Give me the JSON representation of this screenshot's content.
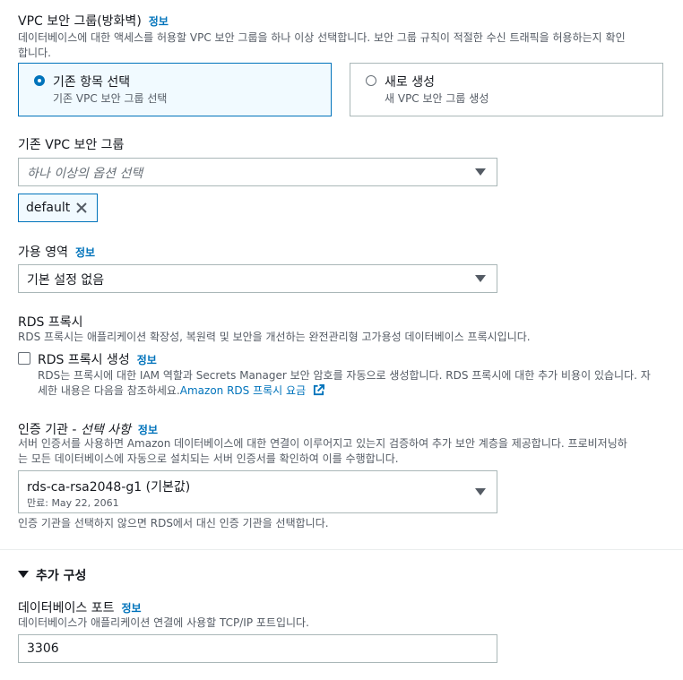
{
  "vpc_sg": {
    "title": "VPC 보안 그룹(방화벽)",
    "info": "정보",
    "desc_line1": "데이터베이스에 대한 액세스를 허용할 VPC 보안 그룹을 하나 이상 선택합니다. 보안 그룹 규칙이 적절한 수신 트래픽을 허용하는지 확인",
    "desc_line2": "합니다.",
    "options": [
      {
        "title": "기존 항목 선택",
        "sub": "기존 VPC 보안 그룹 선택",
        "selected": true
      },
      {
        "title": "새로 생성",
        "sub": "새 VPC 보안 그룹 생성",
        "selected": false
      }
    ]
  },
  "existing_sg": {
    "label": "기존 VPC 보안 그룹",
    "placeholder": "하나 이상의 옵션 선택",
    "token": "default"
  },
  "az": {
    "label": "가용 영역",
    "info": "정보",
    "value": "기본 설정 없음"
  },
  "rds_proxy": {
    "title": "RDS 프록시",
    "desc": "RDS 프록시는 애플리케이션 확장성, 복원력 및 보안을 개선하는 완전관리형 고가용성 데이터베이스 프록시입니다.",
    "checkbox_label": "RDS 프록시 생성",
    "info": "정보",
    "checkbox_desc_line1": "RDS는 프록시에 대한 IAM 역할과 Secrets Manager 보안 암호를 자동으로 생성합니다. RDS 프록시에 대한 추가 비용이 있습니다. 자",
    "checkbox_desc_line2": "세한 내용은 다음을 참조하세요.",
    "pricing_link": "Amazon RDS 프록시 요금"
  },
  "ca": {
    "label": "인증 기관 - ",
    "label_optional": "선택 사항",
    "info": "정보",
    "desc_line1": "서버 인증서를 사용하면 Amazon 데이터베이스에 대한 연결이 이루어지고 있는지 검증하여 추가 보안 계층을 제공합니다. 프로비저닝하",
    "desc_line2": "는 모든 데이터베이스에 자동으로 설치되는 서버 인증서를 확인하여 이를 수행합니다.",
    "value": "rds-ca-rsa2048-g1 (기본값)",
    "value_sub": "만료: May 22, 2061",
    "hint": "인증 기관을 선택하지 않으면 RDS에서 대신 인증 기관을 선택합니다."
  },
  "additional": {
    "title": "추가 구성"
  },
  "db_port": {
    "label": "데이터베이스 포트",
    "info": "정보",
    "desc": "데이터베이스가 애플리케이션 연결에 사용할 TCP/IP 포트입니다.",
    "value": "3306"
  }
}
